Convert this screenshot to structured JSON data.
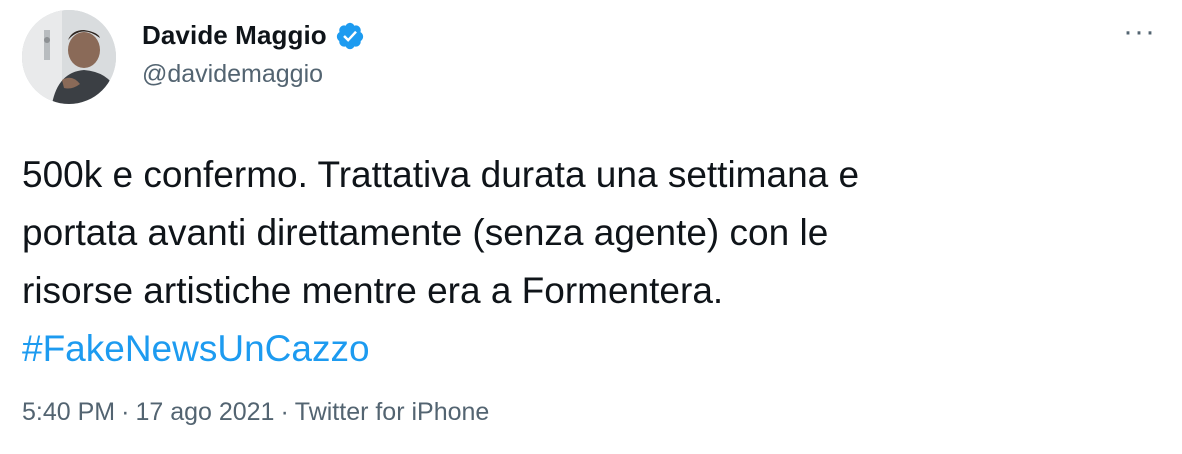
{
  "author": {
    "display_name": "Davide Maggio",
    "handle": "@davidemaggio",
    "verified": true,
    "verified_badge_color": "#1d9bf0"
  },
  "more_menu": {
    "label": "···",
    "icon": "more-horizontal-icon"
  },
  "tweet": {
    "lines": [
      "500k e confermo. Trattativa durata una settimana e",
      "portata avanti direttamente (senza agente) con le",
      "risorse artistiche mentre era a Formentera."
    ],
    "hashtag": "#FakeNewsUnCazzo",
    "hashtag_color": "#1d9bf0"
  },
  "meta": {
    "time": "5:40 PM",
    "separator": "·",
    "date": "17 ago 2021",
    "source": "Twitter for iPhone"
  }
}
